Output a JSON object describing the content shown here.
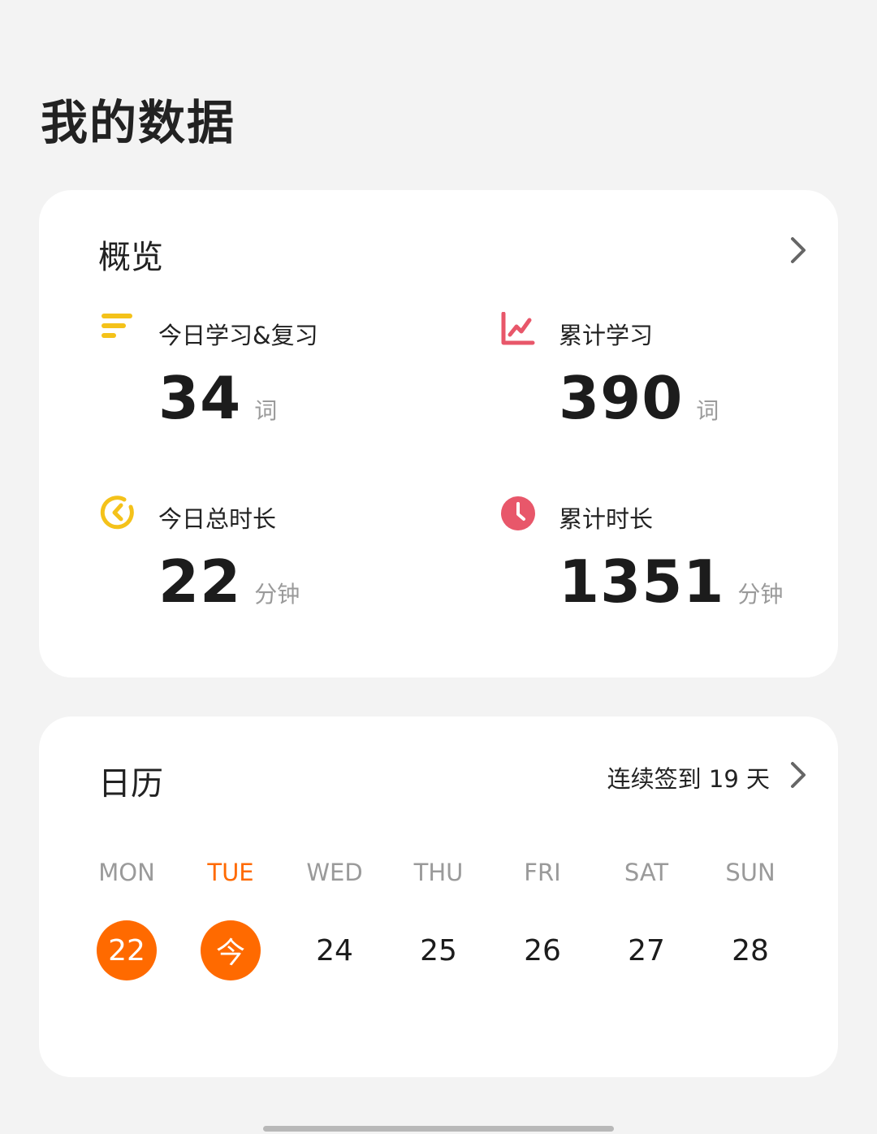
{
  "page": {
    "title": "我的数据"
  },
  "overview": {
    "title": "概览",
    "stats": [
      {
        "label": "今日学习&复习",
        "value": "34",
        "unit": "词",
        "icon": "bars-icon",
        "color": "#f4c21a"
      },
      {
        "label": "累计学习",
        "value": "390",
        "unit": "词",
        "icon": "line-chart-icon",
        "color": "#e8576a"
      },
      {
        "label": "今日总时长",
        "value": "22",
        "unit": "分钟",
        "icon": "timer-ring-icon",
        "color": "#f4c21a"
      },
      {
        "label": "累计时长",
        "value": "1351",
        "unit": "分钟",
        "icon": "clock-icon",
        "color": "#e8576a"
      }
    ]
  },
  "calendar": {
    "title": "日历",
    "streak": "连续签到 19 天",
    "accent_color": "#ff6a00",
    "days": [
      {
        "weekday": "MON",
        "date": "22",
        "checked": true,
        "today": false
      },
      {
        "weekday": "TUE",
        "date": "今",
        "checked": true,
        "today": true
      },
      {
        "weekday": "WED",
        "date": "24",
        "checked": false,
        "today": false
      },
      {
        "weekday": "THU",
        "date": "25",
        "checked": false,
        "today": false
      },
      {
        "weekday": "FRI",
        "date": "26",
        "checked": false,
        "today": false
      },
      {
        "weekday": "SAT",
        "date": "27",
        "checked": false,
        "today": false
      },
      {
        "weekday": "SUN",
        "date": "28",
        "checked": false,
        "today": false
      }
    ]
  }
}
